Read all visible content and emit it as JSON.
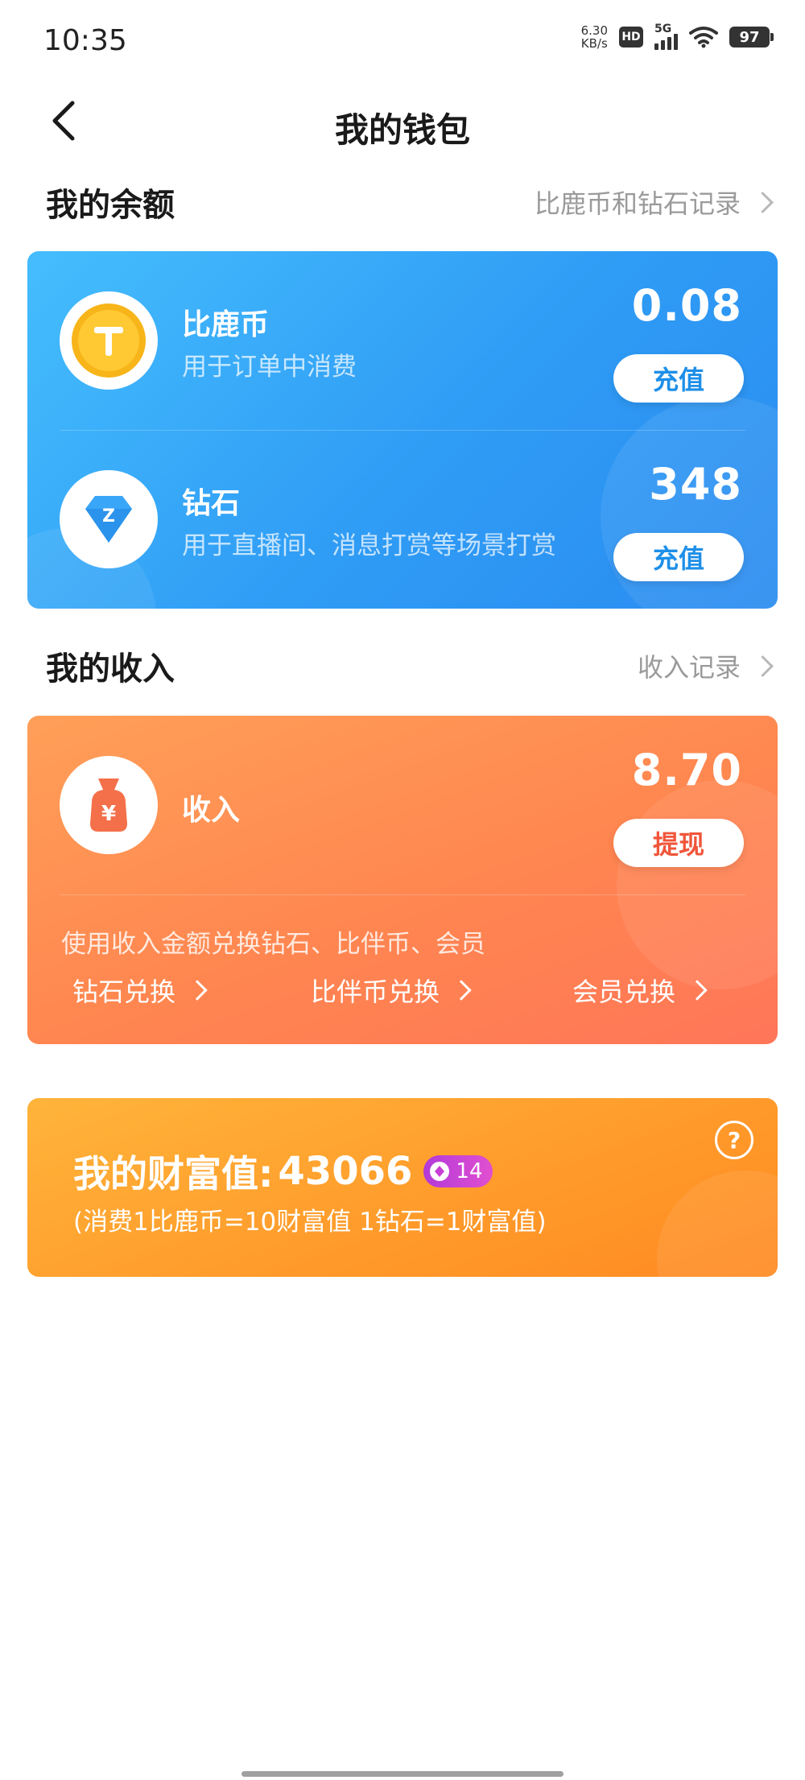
{
  "status_bar": {
    "time": "10:35",
    "net_speed_value": "6.30",
    "net_speed_unit": "KB/s",
    "hd": "HD",
    "network": "5G",
    "battery": "97"
  },
  "nav": {
    "title": "我的钱包",
    "back_icon": "chevron-left-icon"
  },
  "balance_section": {
    "title": "我的余额",
    "link": "比鹿币和钻石记录"
  },
  "balance_card": {
    "coin": {
      "title": "比鹿币",
      "subtitle": "用于订单中消费",
      "amount": "0.08",
      "button": "充值",
      "icon": "gold-coin-icon"
    },
    "diamond": {
      "title": "钻石",
      "subtitle": "用于直播间、消息打赏等场景打赏",
      "amount": "348",
      "button": "充值",
      "icon": "diamond-icon"
    }
  },
  "income_section": {
    "title": "我的收入",
    "link": "收入记录"
  },
  "income_card": {
    "title": "收入",
    "amount": "8.70",
    "button": "提现",
    "note": "使用收入金额兑换钻石、比伴币、会员",
    "links": [
      "钻石兑换",
      "比伴币兑换",
      "会员兑换"
    ],
    "icon": "money-bag-icon"
  },
  "wealth_card": {
    "label": "我的财富值:",
    "value": "43066",
    "level": "14",
    "rule": "(消费1比鹿币=10财富值 1钻石=1财富值)",
    "help": "?"
  },
  "colors": {
    "blue_card": "#2f9cf5",
    "orange_card": "#ff8650",
    "wealth_card": "#ff9a2a",
    "badge": "#c93fd6"
  }
}
